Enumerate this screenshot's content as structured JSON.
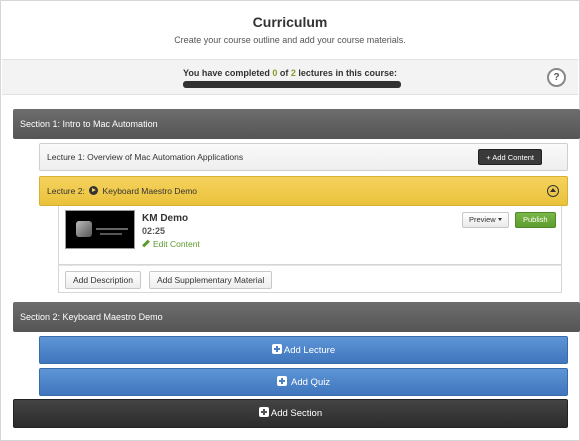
{
  "header": {
    "title": "Curriculum",
    "subtitle": "Create your course outline and add your course materials."
  },
  "progress": {
    "prefix": "You have completed ",
    "completed": "0",
    "middle": " of ",
    "total": "2",
    "suffix": " lectures in this course:",
    "fraction": 0,
    "help_icon": "question-mark-icon",
    "help_label": "?"
  },
  "sections": [
    {
      "label": "Section 1: Intro to Mac Automation"
    },
    {
      "label": "Section 2: Keyboard Maestro Demo"
    }
  ],
  "lectures": [
    {
      "label": "Lecture 1: Overview of Mac Automation Applications",
      "add_content": "+ Add Content"
    },
    {
      "prefix": "Lecture 2: ",
      "title": "Keyboard Maestro Demo"
    }
  ],
  "media": {
    "title": "KM Demo",
    "duration": "02:25",
    "edit_label": "Edit Content",
    "preview_label": "Preview",
    "publish_label": "Publish"
  },
  "actions": {
    "add_description": "Add Description",
    "add_supplementary": "Add Supplementary Material"
  },
  "buttons": {
    "add_lecture": "Add Lecture",
    "add_quiz": "Add Quiz",
    "add_section": "Add Section"
  },
  "colors": {
    "active_lecture": "#eac23b",
    "primary_blue": "#4a80c6",
    "publish_green": "#5e9c30",
    "section_gray": "#5e5e5e"
  }
}
